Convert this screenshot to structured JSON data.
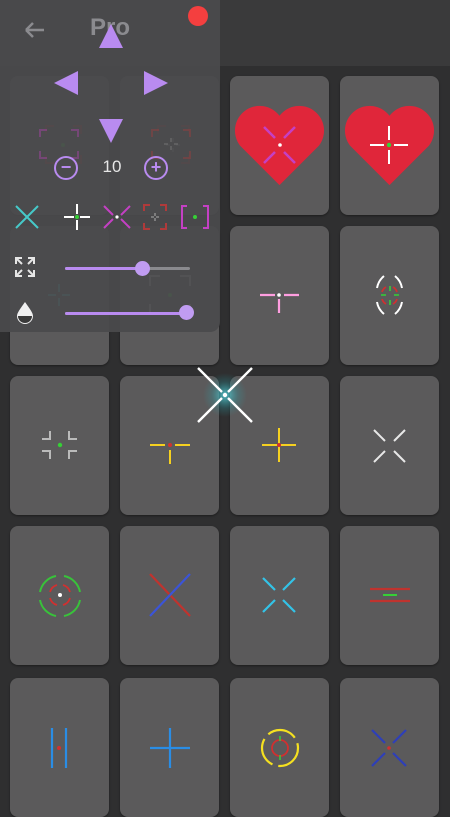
{
  "app": {
    "title": "Pro",
    "size_value": "10",
    "controls": {
      "back_icon": "arrow-left-icon",
      "close_dot_color": "#f43f3f",
      "accent": "#b98bf0"
    }
  },
  "sliders": {
    "scale_level": 0.62,
    "opacity_level": 0.97
  },
  "crosshairs": [
    {
      "id": "c1",
      "favorite": false,
      "style": "brackets-cross",
      "color": "#b03a3a"
    },
    {
      "id": "c2",
      "favorite": false,
      "style": "square-brackets",
      "color": "#b03a3a"
    },
    {
      "id": "c3",
      "favorite": true,
      "style": "magenta-x",
      "color": "#c440c4"
    },
    {
      "id": "c4",
      "favorite": true,
      "style": "white-plus-green-dot",
      "color": "#ffffff"
    },
    {
      "id": "c5",
      "favorite": false,
      "style": "teal-plus",
      "color": "#46c9c9"
    },
    {
      "id": "c6",
      "favorite": false,
      "style": "bracket-corners",
      "color": "#bbbbbb"
    },
    {
      "id": "c7",
      "favorite": false,
      "style": "pink-t",
      "color": "#ff9ee0"
    },
    {
      "id": "c8",
      "favorite": false,
      "style": "circle-segments",
      "color": "#ffffff"
    },
    {
      "id": "c9",
      "favorite": false,
      "style": "corner-brackets-green",
      "color": "#bbbbbb"
    },
    {
      "id": "c10",
      "favorite": false,
      "style": "yellow-t",
      "color": "#f5d020"
    },
    {
      "id": "c11",
      "favorite": false,
      "style": "yellow-plus",
      "color": "#f5d020"
    },
    {
      "id": "c12",
      "favorite": false,
      "style": "white-x",
      "color": "#e8e8e8"
    },
    {
      "id": "c13",
      "favorite": false,
      "style": "green-circle-red",
      "color": "#38c33a"
    },
    {
      "id": "c14",
      "favorite": false,
      "style": "red-blue-x",
      "color": "#3b54d8"
    },
    {
      "id": "c15",
      "favorite": false,
      "style": "cyan-x",
      "color": "#33c3e8"
    },
    {
      "id": "c16",
      "favorite": false,
      "style": "red-green-lines",
      "color": "#c0332e"
    },
    {
      "id": "c17",
      "favorite": false,
      "style": "blue-parallel",
      "color": "#2a8de5"
    },
    {
      "id": "c18",
      "favorite": false,
      "style": "blue-plus",
      "color": "#2a8de5"
    },
    {
      "id": "c19",
      "favorite": false,
      "style": "rainbow-circle",
      "color": "#f5e020"
    },
    {
      "id": "c20",
      "favorite": false,
      "style": "navy-x",
      "color": "#2e3fb8"
    }
  ]
}
